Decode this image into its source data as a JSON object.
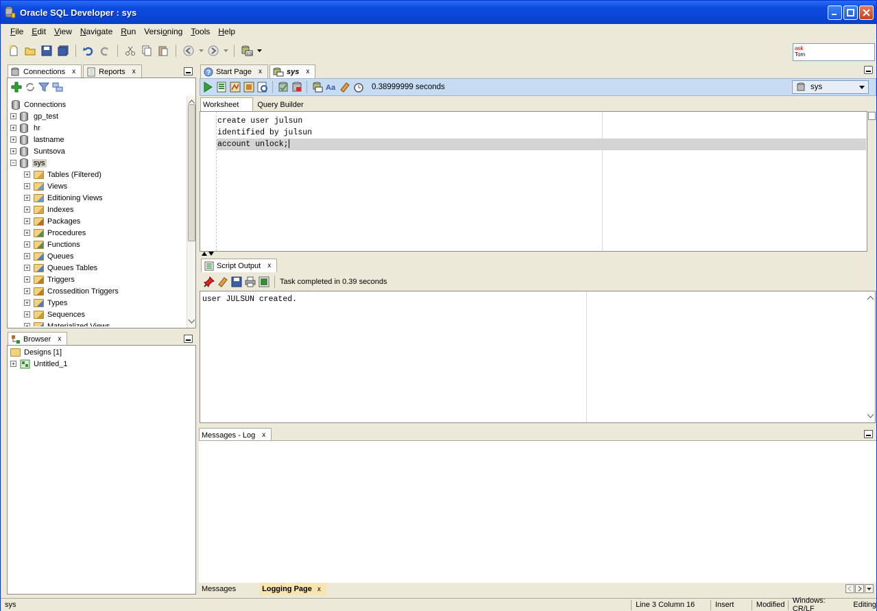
{
  "window": {
    "title": "Oracle SQL Developer : sys"
  },
  "menus": [
    {
      "label": "File",
      "u": "F",
      "rest": "ile"
    },
    {
      "label": "Edit",
      "u": "E",
      "rest": "dit"
    },
    {
      "label": "View",
      "u": "V",
      "rest": "iew"
    },
    {
      "label": "Navigate",
      "u": "N",
      "rest": "avigate"
    },
    {
      "label": "Run",
      "u": "R",
      "rest": "un"
    },
    {
      "label": "Versioning",
      "pre": "Versi",
      "u": "o",
      "rest": "ning"
    },
    {
      "label": "Tools",
      "u": "T",
      "rest": "ools"
    },
    {
      "label": "Help",
      "u": "H",
      "rest": "elp"
    }
  ],
  "ask": {
    "line1": "ask",
    "line2": "Tom"
  },
  "left_top": {
    "tabs": {
      "connections": "Connections",
      "reports": "Reports"
    },
    "root": "Connections",
    "connections": [
      "gp_test",
      "hr",
      "lastname",
      "Suntsova",
      "sys"
    ],
    "sys_children": [
      "Tables (Filtered)",
      "Views",
      "Editioning Views",
      "Indexes",
      "Packages",
      "Procedures",
      "Functions",
      "Queues",
      "Queues Tables",
      "Triggers",
      "Crossedition Triggers",
      "Types",
      "Sequences",
      "Materialized Views"
    ]
  },
  "browser": {
    "tab": "Browser",
    "items": [
      "Designs [1]",
      "Untitled_1"
    ]
  },
  "editor": {
    "tabs": {
      "start": "Start Page",
      "sys": "sys"
    },
    "exec_time": "0.38999999 seconds",
    "connection": "sys",
    "subtabs": {
      "worksheet": "Worksheet",
      "query_builder": "Query Builder"
    },
    "lines": [
      "create user julsun",
      "identified by julsun",
      "account unlock;"
    ]
  },
  "script_output": {
    "tab": "Script Output",
    "status": "Task completed in 0.39 seconds",
    "text": "user JULSUN created."
  },
  "messages": {
    "tab": "Messages - Log",
    "bottom_tabs": {
      "messages": "Messages",
      "logging": "Logging Page"
    }
  },
  "status": {
    "left": "sys",
    "position": "Line 3 Column 16",
    "mode": "Insert",
    "modified": "Modified",
    "eol": "Windows: CR/LF",
    "state": "Editing"
  }
}
